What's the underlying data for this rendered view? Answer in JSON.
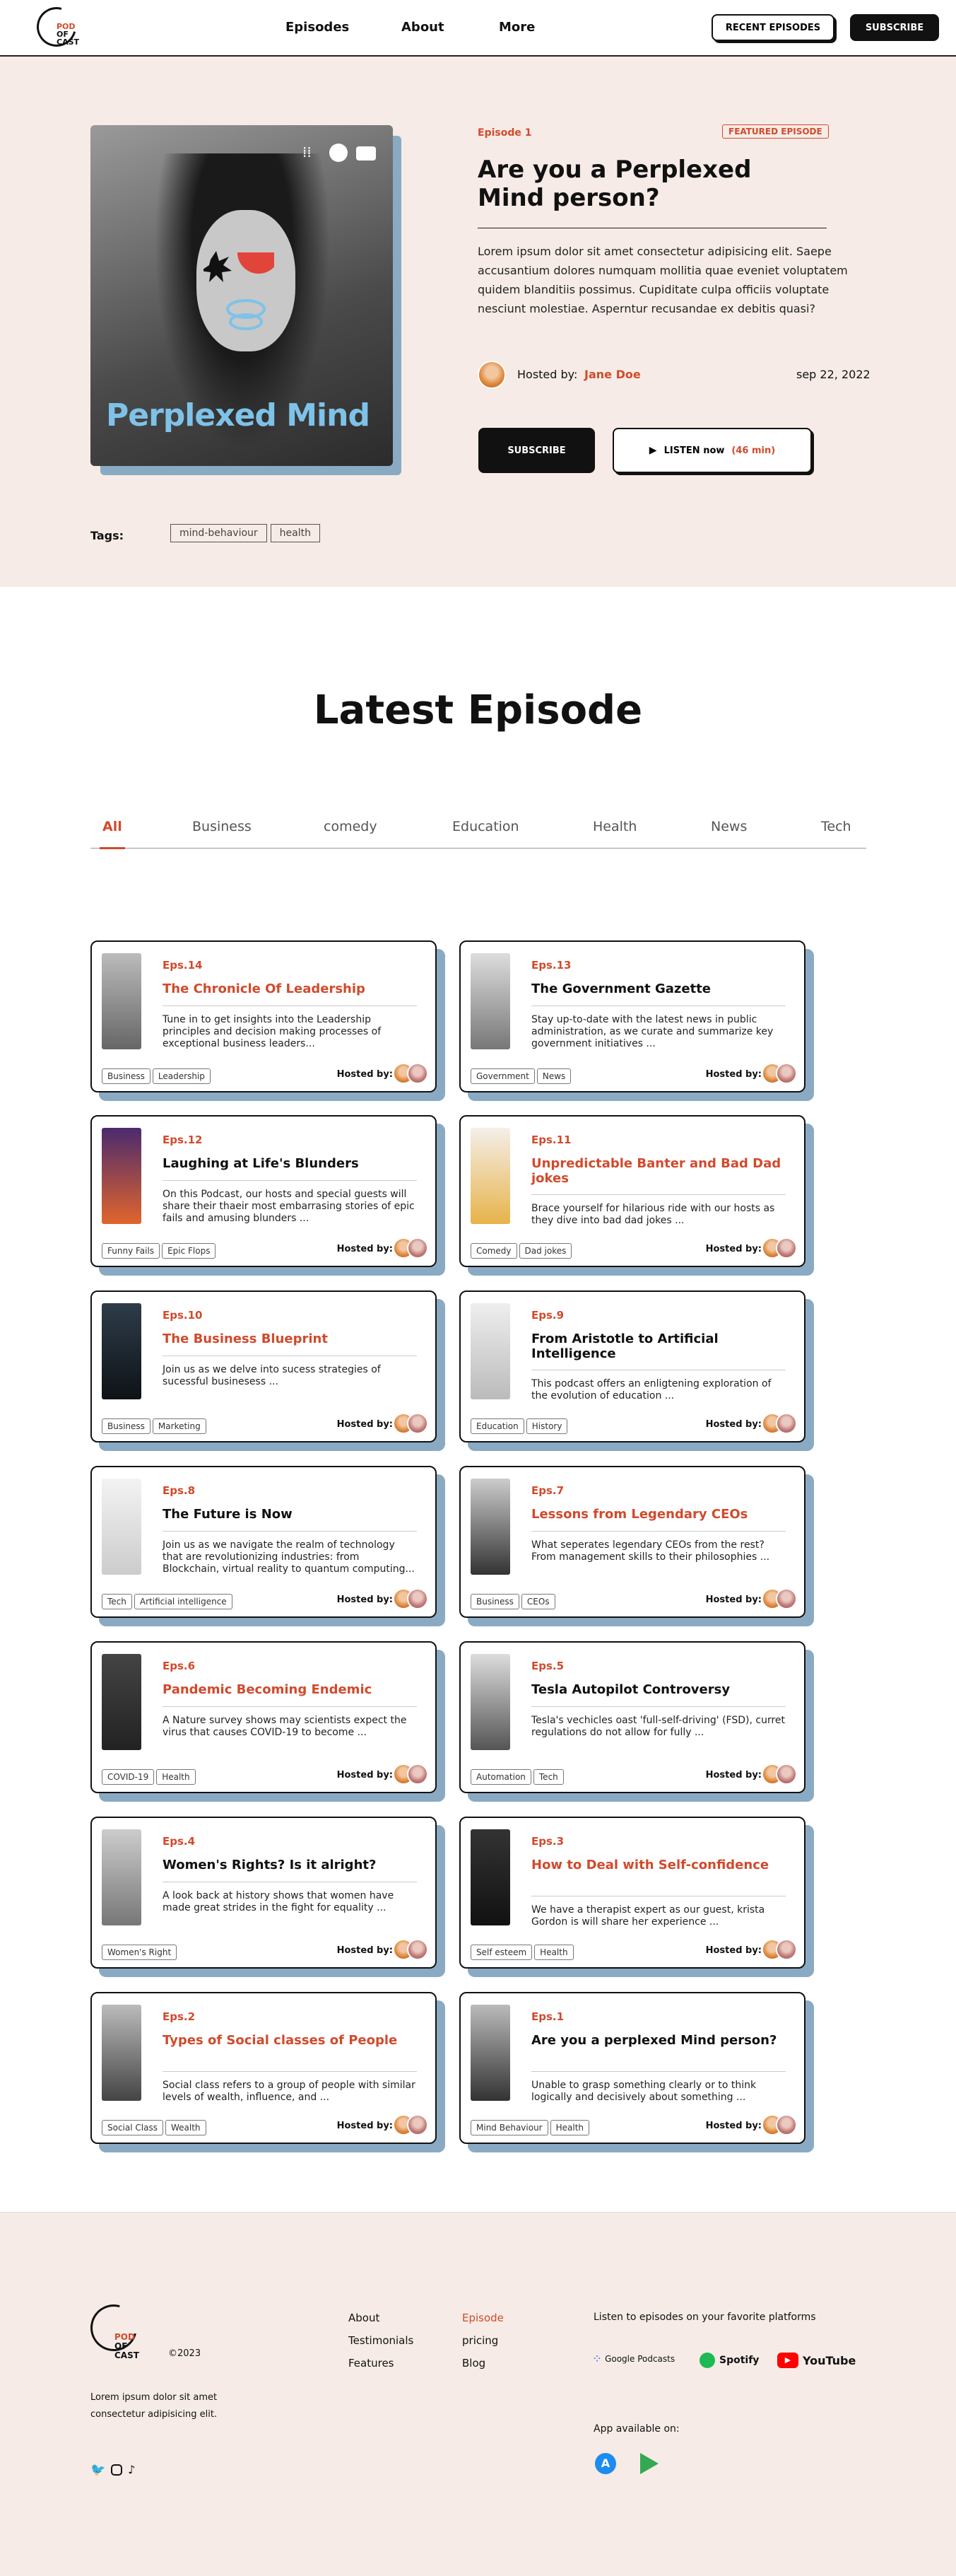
{
  "header": {
    "logo_lines": [
      "POD",
      "OF",
      "CAST"
    ],
    "nav": [
      "Episodes",
      "About",
      "More"
    ],
    "recent_label": "RECENT EPISODES",
    "subscribe_label": "SUBSCRIBE"
  },
  "hero": {
    "episode": "Episode 1",
    "badge": "FEATURED EPISODE",
    "title": "Are you a Perplexed Mind person?",
    "cover_title": "Perplexed Mind",
    "description": "Lorem ipsum dolor sit amet consectetur adipisicing elit. Saepe accusantium dolores numquam mollitia quae eveniet voluptatem quidem blanditiis possimus. Cupiditate culpa officiis voluptate nesciunt molestiae. Asperntur recusandae ex debitis quasi?",
    "hosted_label": "Hosted by:",
    "host": "Jane Doe",
    "date": "sep 22, 2022",
    "subscribe_label": "SUBSCRIBE",
    "listen_label": "LISTEN now",
    "duration": "(46 min)",
    "tags_label": "Tags:",
    "tags": [
      "mind-behaviour",
      "health"
    ],
    "platform_icons": [
      "google-podcasts-icon",
      "spotify-icon",
      "youtube-icon"
    ]
  },
  "latest": {
    "title": "Latest Episode",
    "filters": [
      "All",
      "Business",
      "comedy",
      "Education",
      "Health",
      "News",
      "Tech"
    ],
    "active_filter": "All"
  },
  "episodes": [
    {
      "eps": "Eps.14",
      "title": "The Chronicle Of Leadership",
      "desc": "Tune in to get insights into the Leadership principles and decision making processes of exceptional business leaders...",
      "tags": [
        "Business",
        "Leadership"
      ],
      "red": true
    },
    {
      "eps": "Eps.13",
      "title": "The Government Gazette",
      "desc": "Stay up-to-date with the latest news in public administration, as we curate and summarize key government initiatives ...",
      "tags": [
        "Government",
        "News"
      ],
      "red": false
    },
    {
      "eps": "Eps.12",
      "title": "Laughing at Life's Blunders",
      "desc": "On this Podcast, our hosts and special guests will share their thaeir most embarrasing stories of epic fails and amusing blunders ...",
      "tags": [
        "Funny Fails",
        "Epic Flops"
      ],
      "red": false
    },
    {
      "eps": "Eps.11",
      "title": "Unpredictable Banter and Bad Dad jokes",
      "desc": "Brace yourself for hilarious ride with our hosts as they dive into bad dad jokes ...",
      "tags": [
        "Comedy",
        "Dad jokes"
      ],
      "red": true
    },
    {
      "eps": "Eps.10",
      "title": "The Business Blueprint",
      "desc": "Join us as we delve into sucess strategies of sucessful businesess ...",
      "tags": [
        "Business",
        "Marketing"
      ],
      "red": true
    },
    {
      "eps": "Eps.9",
      "title": "From Aristotle to Artificial Intelligence",
      "desc": "This podcast offers an enligtening exploration of the evolution of education ...",
      "tags": [
        "Education",
        "History"
      ],
      "red": false
    },
    {
      "eps": "Eps.8",
      "title": "The Future is Now",
      "desc": "Join us as we navigate the realm of technology that are revolutionizing industries: from Blockchain, virtual reality to quantum computing...",
      "tags": [
        "Tech",
        "Artificial intelligence"
      ],
      "red": false
    },
    {
      "eps": "Eps.7",
      "title": "Lessons from Legendary CEOs",
      "desc": "What seperates legendary CEOs from the rest? From management skills to their philosophies ...",
      "tags": [
        "Business",
        "CEOs"
      ],
      "red": true
    },
    {
      "eps": "Eps.6",
      "title": "Pandemic Becoming Endemic",
      "desc": "A Nature survey shows may scientists expect the virus that causes COVID-19 to become ...",
      "tags": [
        "COVID-19",
        "Health"
      ],
      "red": true
    },
    {
      "eps": "Eps.5",
      "title": "Tesla Autopilot Controversy",
      "desc": "Tesla's vechicles oast 'full-self-driving' (FSD), curret regulations do not allow for fully ...",
      "tags": [
        "Automation",
        "Tech"
      ],
      "red": false
    },
    {
      "eps": "Eps.4",
      "title": "Women's Rights? Is it alright?",
      "desc": "A look back at history shows that women have made great strides in the fight for equality ...",
      "tags": [
        "Women's Right"
      ],
      "red": false
    },
    {
      "eps": "Eps.3",
      "title": "How to Deal with Self-confidence",
      "desc": "We have a therapist expert as our guest, krista Gordon is will share her experience ...",
      "tags": [
        "Self esteem",
        "Health"
      ],
      "red": true
    },
    {
      "eps": "Eps.2",
      "title": "Types of Social classes of People",
      "desc": "Social class refers to a group of people with similar levels of wealth, influence, and ...",
      "tags": [
        "Social Class",
        "Wealth"
      ],
      "red": true
    },
    {
      "eps": "Eps.1",
      "title": "Are you a perplexed Mind person?",
      "desc": "Unable to grasp something clearly or to think logically and decisively about something ...",
      "tags": [
        "Mind Behaviour",
        "Health"
      ],
      "red": false
    }
  ],
  "card_hosted_label": "Hosted by:",
  "footer": {
    "logo_lines": [
      "POD",
      "OF",
      "CAST"
    ],
    "copyright": "©2023",
    "blurb": "Lorem ipsum dolor sit amet consectetur adipisicing elit.",
    "col1": [
      "About",
      "Testimonials",
      "Features"
    ],
    "col2": [
      "Episode",
      "pricing",
      "Blog"
    ],
    "platforms_label": "Listen to episodes on your favorite platforms",
    "platforms": [
      "Google Podcasts",
      "Spotify",
      "YouTube"
    ],
    "app_label": "App available on:",
    "accent": "#d14a2c"
  }
}
